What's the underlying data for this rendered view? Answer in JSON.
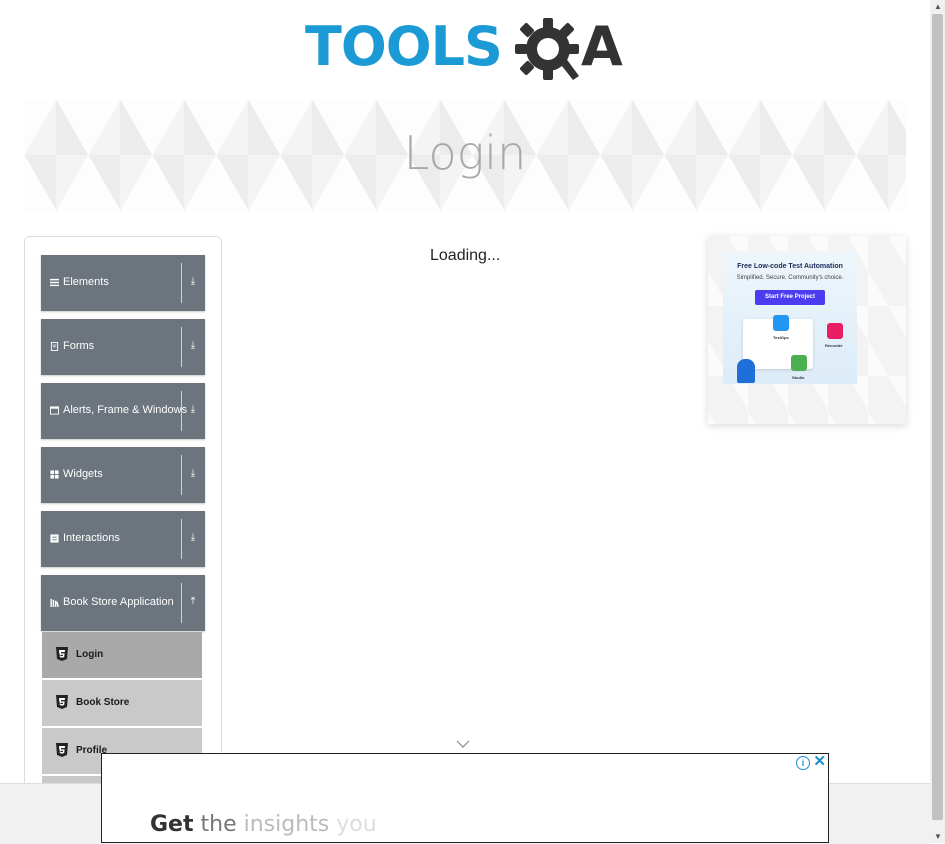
{
  "header": {
    "logo_text_left": "TOOLS",
    "logo_text_right": "A",
    "logo_alt": "ToolsQA"
  },
  "banner": {
    "title": "Login"
  },
  "sidebar": {
    "groups": [
      {
        "label": "Elements",
        "icon": "menu-icon",
        "arrow": "⤓"
      },
      {
        "label": "Forms",
        "icon": "document-icon",
        "arrow": "⤓"
      },
      {
        "label": "Alerts, Frame & Windows",
        "icon": "window-icon",
        "arrow": "⤓"
      },
      {
        "label": "Widgets",
        "icon": "grid-icon",
        "arrow": "⤓"
      },
      {
        "label": "Interactions",
        "icon": "square-icon",
        "arrow": "⤓"
      },
      {
        "label": "Book Store Application",
        "icon": "library-icon",
        "arrow": "⤒"
      }
    ],
    "book_store_items": [
      {
        "label": "Login",
        "icon": "html5-icon",
        "active": true
      },
      {
        "label": "Book Store",
        "icon": "html5-icon",
        "active": false
      },
      {
        "label": "Profile",
        "icon": "html5-icon",
        "active": false
      }
    ]
  },
  "main": {
    "loading_text": "Loading..."
  },
  "side_ad": {
    "title": "Free Low-code Test Automation",
    "subtitle": "Simplified. Secure. Community's choice.",
    "button": "Start Free Project",
    "tags": [
      "TestOps",
      "Recorder",
      "Studio"
    ],
    "brand_color": "#4b3cf0"
  },
  "bottom_ad": {
    "words": [
      "Get",
      "the",
      "insights",
      "you"
    ],
    "info_glyph": "i",
    "close_glyph": "✕"
  }
}
